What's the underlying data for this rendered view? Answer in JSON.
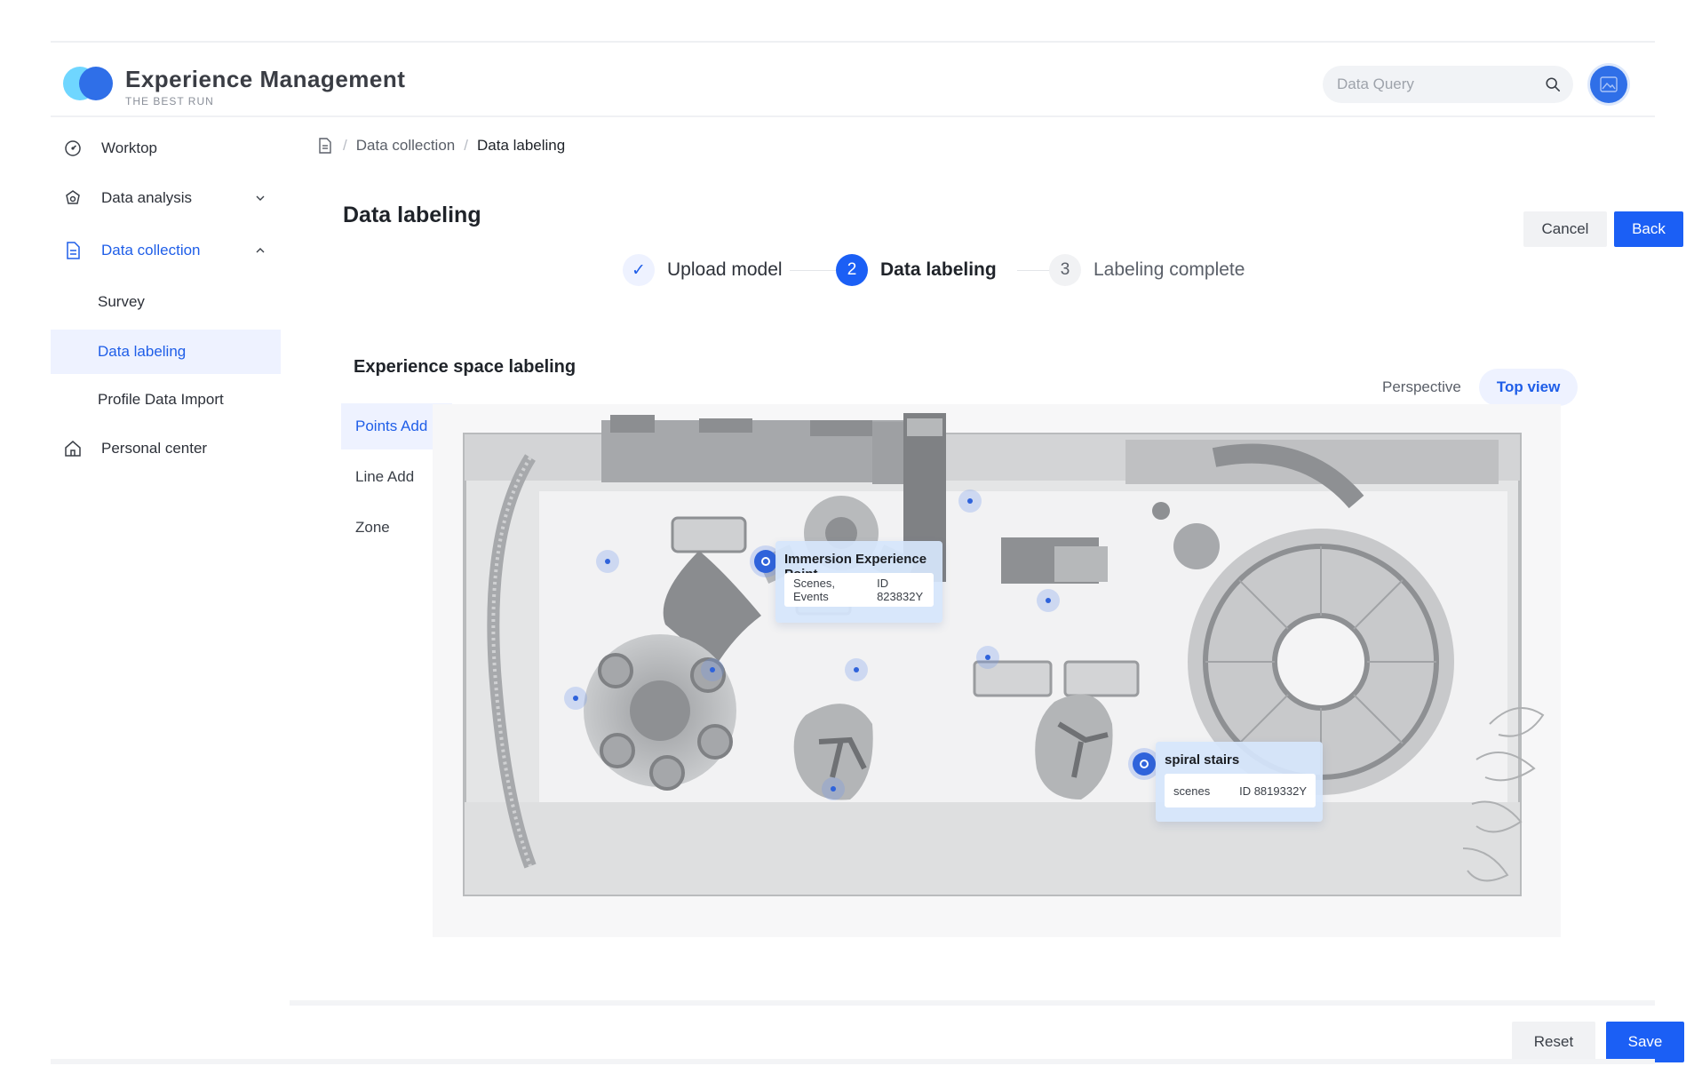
{
  "app": {
    "title": "Experience Management",
    "subtitle": "THE BEST RUN",
    "brand_colors": {
      "primary": "#1b5ff5",
      "logo_light": "#6fd6ff",
      "logo_dark": "#2f6fe8"
    }
  },
  "header": {
    "search": {
      "placeholder": "Data Query",
      "value": "",
      "icon": "search-icon"
    },
    "avatar_icon": "image-icon"
  },
  "sidebar": {
    "items": [
      {
        "label": "Worktop",
        "icon": "dashboard-icon"
      },
      {
        "label": "Data analysis",
        "icon": "analysis-icon",
        "expanded": false
      },
      {
        "label": "Data collection",
        "icon": "document-icon",
        "expanded": true,
        "active": true
      },
      {
        "label": "Personal center",
        "icon": "home-icon"
      }
    ],
    "subitems": [
      {
        "label": "Survey"
      },
      {
        "label": "Data labeling",
        "selected": true
      },
      {
        "label": "Profile Data Import"
      }
    ]
  },
  "breadcrumb": {
    "icon": "document-icon",
    "items": [
      "Data collection",
      "Data labeling"
    ],
    "separator": "/"
  },
  "page": {
    "title": "Data labeling",
    "cancel_label": "Cancel",
    "back_label": "Back"
  },
  "steps": [
    {
      "label": "Upload model",
      "status": "done",
      "marker": "✓"
    },
    {
      "label": "Data labeling",
      "status": "current",
      "marker": "2"
    },
    {
      "label": "Labeling complete",
      "status": "pending",
      "marker": "3"
    }
  ],
  "labeling": {
    "title": "Experience space labeling",
    "views": [
      "Perspective",
      "Top view"
    ],
    "selected_view": "Top view",
    "tools": [
      "Points Add",
      "Line Add",
      "Zone"
    ],
    "selected_tool": "Points Add",
    "cards": [
      {
        "title": "Immersion Experience Point",
        "tags": "Scenes, Events",
        "id": "ID 823832Y"
      },
      {
        "title": "spiral stairs",
        "tags": "scenes",
        "id": "ID 8819332Y"
      }
    ]
  },
  "footer": {
    "reset_label": "Reset",
    "save_label": "Save"
  }
}
